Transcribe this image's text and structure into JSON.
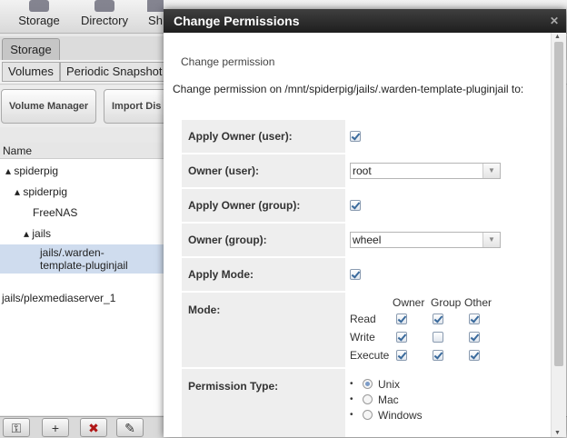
{
  "topnav": {
    "storage": "Storage",
    "directory": "Directory",
    "sharing_partial": "Sh"
  },
  "tabs": {
    "storage": "Storage",
    "volumes": "Volumes",
    "periodic": "Periodic Snapshot T"
  },
  "toolbar": {
    "volume_manager": "Volume Manager",
    "import_disk": "Import Dis"
  },
  "tree": {
    "header": "Name",
    "nodes": {
      "pool1": "spiderpig",
      "pool2": "spiderpig",
      "freenas": "FreeNAS",
      "jails": "jails",
      "template_line1": "jails/.warden-",
      "template_line2": "template-pluginjail",
      "plex": "jails/plexmediaserver_1"
    }
  },
  "modal": {
    "title": "Change Permissions",
    "close": "✕",
    "subheading": "Change permission",
    "description": "Change permission on /mnt/spiderpig/jails/.warden-template-pluginjail to:",
    "fields": {
      "apply_owner_user": "Apply Owner (user):",
      "owner_user": "Owner (user):",
      "owner_user_value": "root",
      "apply_owner_group": "Apply Owner (group):",
      "owner_group": "Owner (group):",
      "owner_group_value": "wheel",
      "apply_mode": "Apply Mode:",
      "mode": "Mode:",
      "permission_type": "Permission Type:"
    },
    "mode_grid": {
      "col_owner": "Owner",
      "col_group": "Group",
      "col_other": "Other",
      "row_read": "Read",
      "row_write": "Write",
      "row_execute": "Execute",
      "checked": {
        "read": [
          true,
          true,
          true
        ],
        "write": [
          true,
          false,
          true
        ],
        "execute": [
          true,
          true,
          true
        ]
      }
    },
    "permission_types": [
      "Unix",
      "Mac",
      "Windows"
    ],
    "permission_selected": "Unix"
  },
  "bottom_icons": [
    "key-icon",
    "add-dataset-icon",
    "delete-icon",
    "wrench-icon"
  ]
}
